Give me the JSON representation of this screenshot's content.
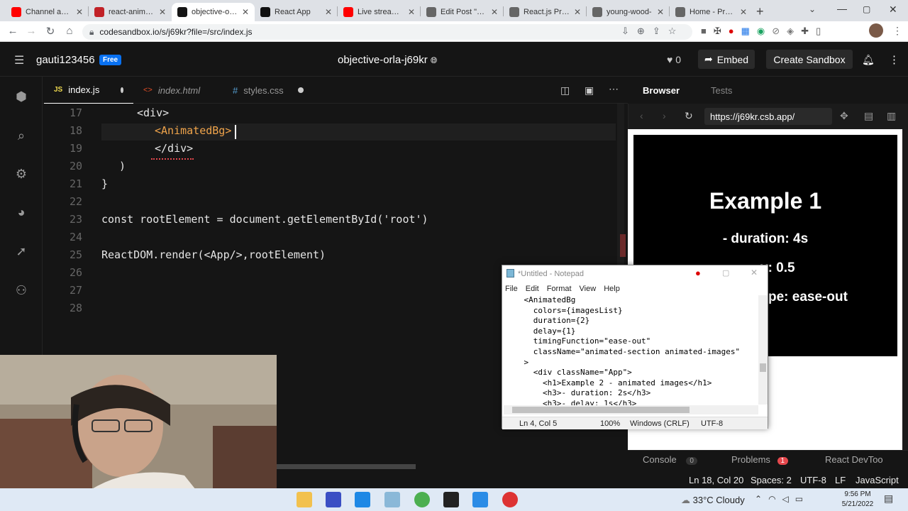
{
  "chrome": {
    "tabs": [
      {
        "label": "Channel analy",
        "fav": "#ff0000",
        "active": false
      },
      {
        "label": "react-animate",
        "fav": "#c12127",
        "active": false
      },
      {
        "label": "objective-orla",
        "fav": "#151515",
        "active": true
      },
      {
        "label": "React App",
        "fav": "#111111",
        "active": false
      },
      {
        "label": "Live streaming",
        "fav": "#ff0000",
        "active": false
      },
      {
        "label": "Edit Post \"Rea",
        "fav": "#666666",
        "active": false
      },
      {
        "label": "React.js Proje",
        "fav": "#666666",
        "active": false
      },
      {
        "label": "young-wood-",
        "fav": "#666666",
        "active": false
      },
      {
        "label": "Home - ProCo",
        "fav": "#666666",
        "active": false
      }
    ],
    "url": "codesandbox.io/s/j69kr?file=/src/index.js"
  },
  "header": {
    "username": "gauti123456",
    "plan_badge": "Free",
    "project_name": "objective-orla-j69kr",
    "likes": "0",
    "embed_label": "Embed",
    "create_label": "Create Sandbox"
  },
  "editor": {
    "tabs": [
      {
        "label": "index.js",
        "prefix": "JS",
        "active": true
      },
      {
        "label": "index.html",
        "prefix": "<>",
        "active": false
      },
      {
        "label": "styles.css",
        "prefix": "#",
        "active": false
      }
    ],
    "lines": [
      {
        "num": "17",
        "text": "<div>"
      },
      {
        "num": "18",
        "text": "<AnimatedBg>"
      },
      {
        "num": "19",
        "text": "</div>"
      },
      {
        "num": "20",
        "text": ")"
      },
      {
        "num": "21",
        "text": "}"
      },
      {
        "num": "22",
        "text": ""
      },
      {
        "num": "23",
        "text": "const rootElement = document.getElementById('root')"
      },
      {
        "num": "24",
        "text": ""
      },
      {
        "num": "25",
        "text": "ReactDOM.render(<App/>,rootElement)"
      },
      {
        "num": "26",
        "text": ""
      },
      {
        "num": "27",
        "text": ""
      },
      {
        "num": "28",
        "text": ""
      }
    ]
  },
  "browser": {
    "tab_browser": "Browser",
    "tab_tests": "Tests",
    "url": "https://j69kr.csb.app/",
    "heading": "Example 1",
    "lines": [
      "- duration: 4s",
      "y: 0.5",
      "pe: ease-out"
    ],
    "console": "Console",
    "console_count": "0",
    "problems": "Problems",
    "problems_count": "1",
    "devtools": "React DevToo"
  },
  "status": {
    "position": "Ln 18, Col 20",
    "spaces": "Spaces: 2",
    "encoding": "UTF-8",
    "eol": "LF",
    "language": "JavaScript"
  },
  "notepad": {
    "title": "*Untitled - Notepad",
    "menu": [
      "File",
      "Edit",
      "Format",
      "View",
      "Help"
    ],
    "text": "    <AnimatedBg\n      colors={imagesList}\n      duration={2}\n      delay={1}\n      timingFunction=\"ease-out\"\n      className=\"animated-section animated-images\"\n    >\n      <div className=\"App\">\n        <h1>Example 2 - animated images</h1>\n        <h3>- duration: 2s</h3>\n        <h3>- delay: 1s</h3>",
    "status_pos": "Ln 4, Col 5",
    "status_zoom": "100%",
    "status_eol": "Windows (CRLF)",
    "status_enc": "UTF-8"
  },
  "taskbar": {
    "weather": "33°C  Cloudy",
    "time": "9:56 PM",
    "date": "5/21/2022"
  }
}
